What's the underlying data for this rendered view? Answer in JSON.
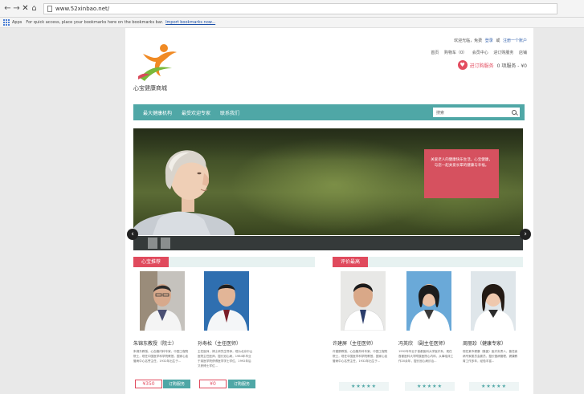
{
  "browser": {
    "back": "←",
    "forward": "→",
    "close": "✕",
    "home": "⌂",
    "url": "www.52xinbao.net/",
    "bookmarks_apps": "Apps",
    "bookmarks_hint": "For quick access, place your bookmarks here on the bookmarks bar.",
    "bookmarks_import": "Import bookmarks now..."
  },
  "header": {
    "logo_text": "心宝健康商城",
    "greeting": "欢迎光临，免费",
    "login": "登录",
    "or": "或",
    "register": "注册一个账户",
    "menu": [
      "首页",
      "购物车（0）",
      "会员中心",
      "进订购服务",
      "店铺"
    ],
    "cart_label": "进订购服务",
    "cart_info": "0 项服务 - ¥0"
  },
  "navbar": {
    "items": [
      "最大健康机构",
      "最受欢迎专家",
      "联系我们"
    ],
    "search_placeholder": "搜索"
  },
  "hero": {
    "box_text": "关爱老人的健康快乐生活，心宝健康，与您一起关爱长辈的健康与幸福。"
  },
  "section_left": {
    "title": "心宝推荐",
    "doctors": [
      {
        "name": "朱锦东教授（院士）",
        "desc": "朱锦东教授，心血管内科专家，中国工程院院士，现任中国医学科学院教授，国家心血管病中心名誉主任，1932年出生于...",
        "price": "¥350",
        "order": "订购服务"
      },
      {
        "name": "孙寿松（主任医师）",
        "desc": "主任医师，博士研究生导师，现为北京中山医院主任医师，擅长冠心病，1984年毕业于某医学院获得医学学士学位，1992年后又获博士学位...",
        "price": "¥0",
        "order": "订购服务"
      }
    ]
  },
  "section_right": {
    "title": "评价最高",
    "doctors": [
      {
        "name": "许建屏（主任医师）",
        "desc": "许建屏教授，心血管外科专家，中国工程院院士，现任中国医学科学院教授，国家心血管病中心名誉主任，1932年出生于...",
        "stars": "★★★★★"
      },
      {
        "name": "冯英欣 （副主任医师）",
        "desc": "1992年毕业于首都医科大学医疗系，现任首都医科大学附属医院心内科，从事临床工作20余年，擅长冠心病诊治...",
        "stars": "★★★★★"
      },
      {
        "name": "周丽珍（健康专家）",
        "desc": "现任某市健康（集团）医疗负责人，曾任疾病专家委员会委员，擅长慢病管理，健康教育工作多年，经验丰富...",
        "stars": "★★★★★"
      }
    ]
  }
}
